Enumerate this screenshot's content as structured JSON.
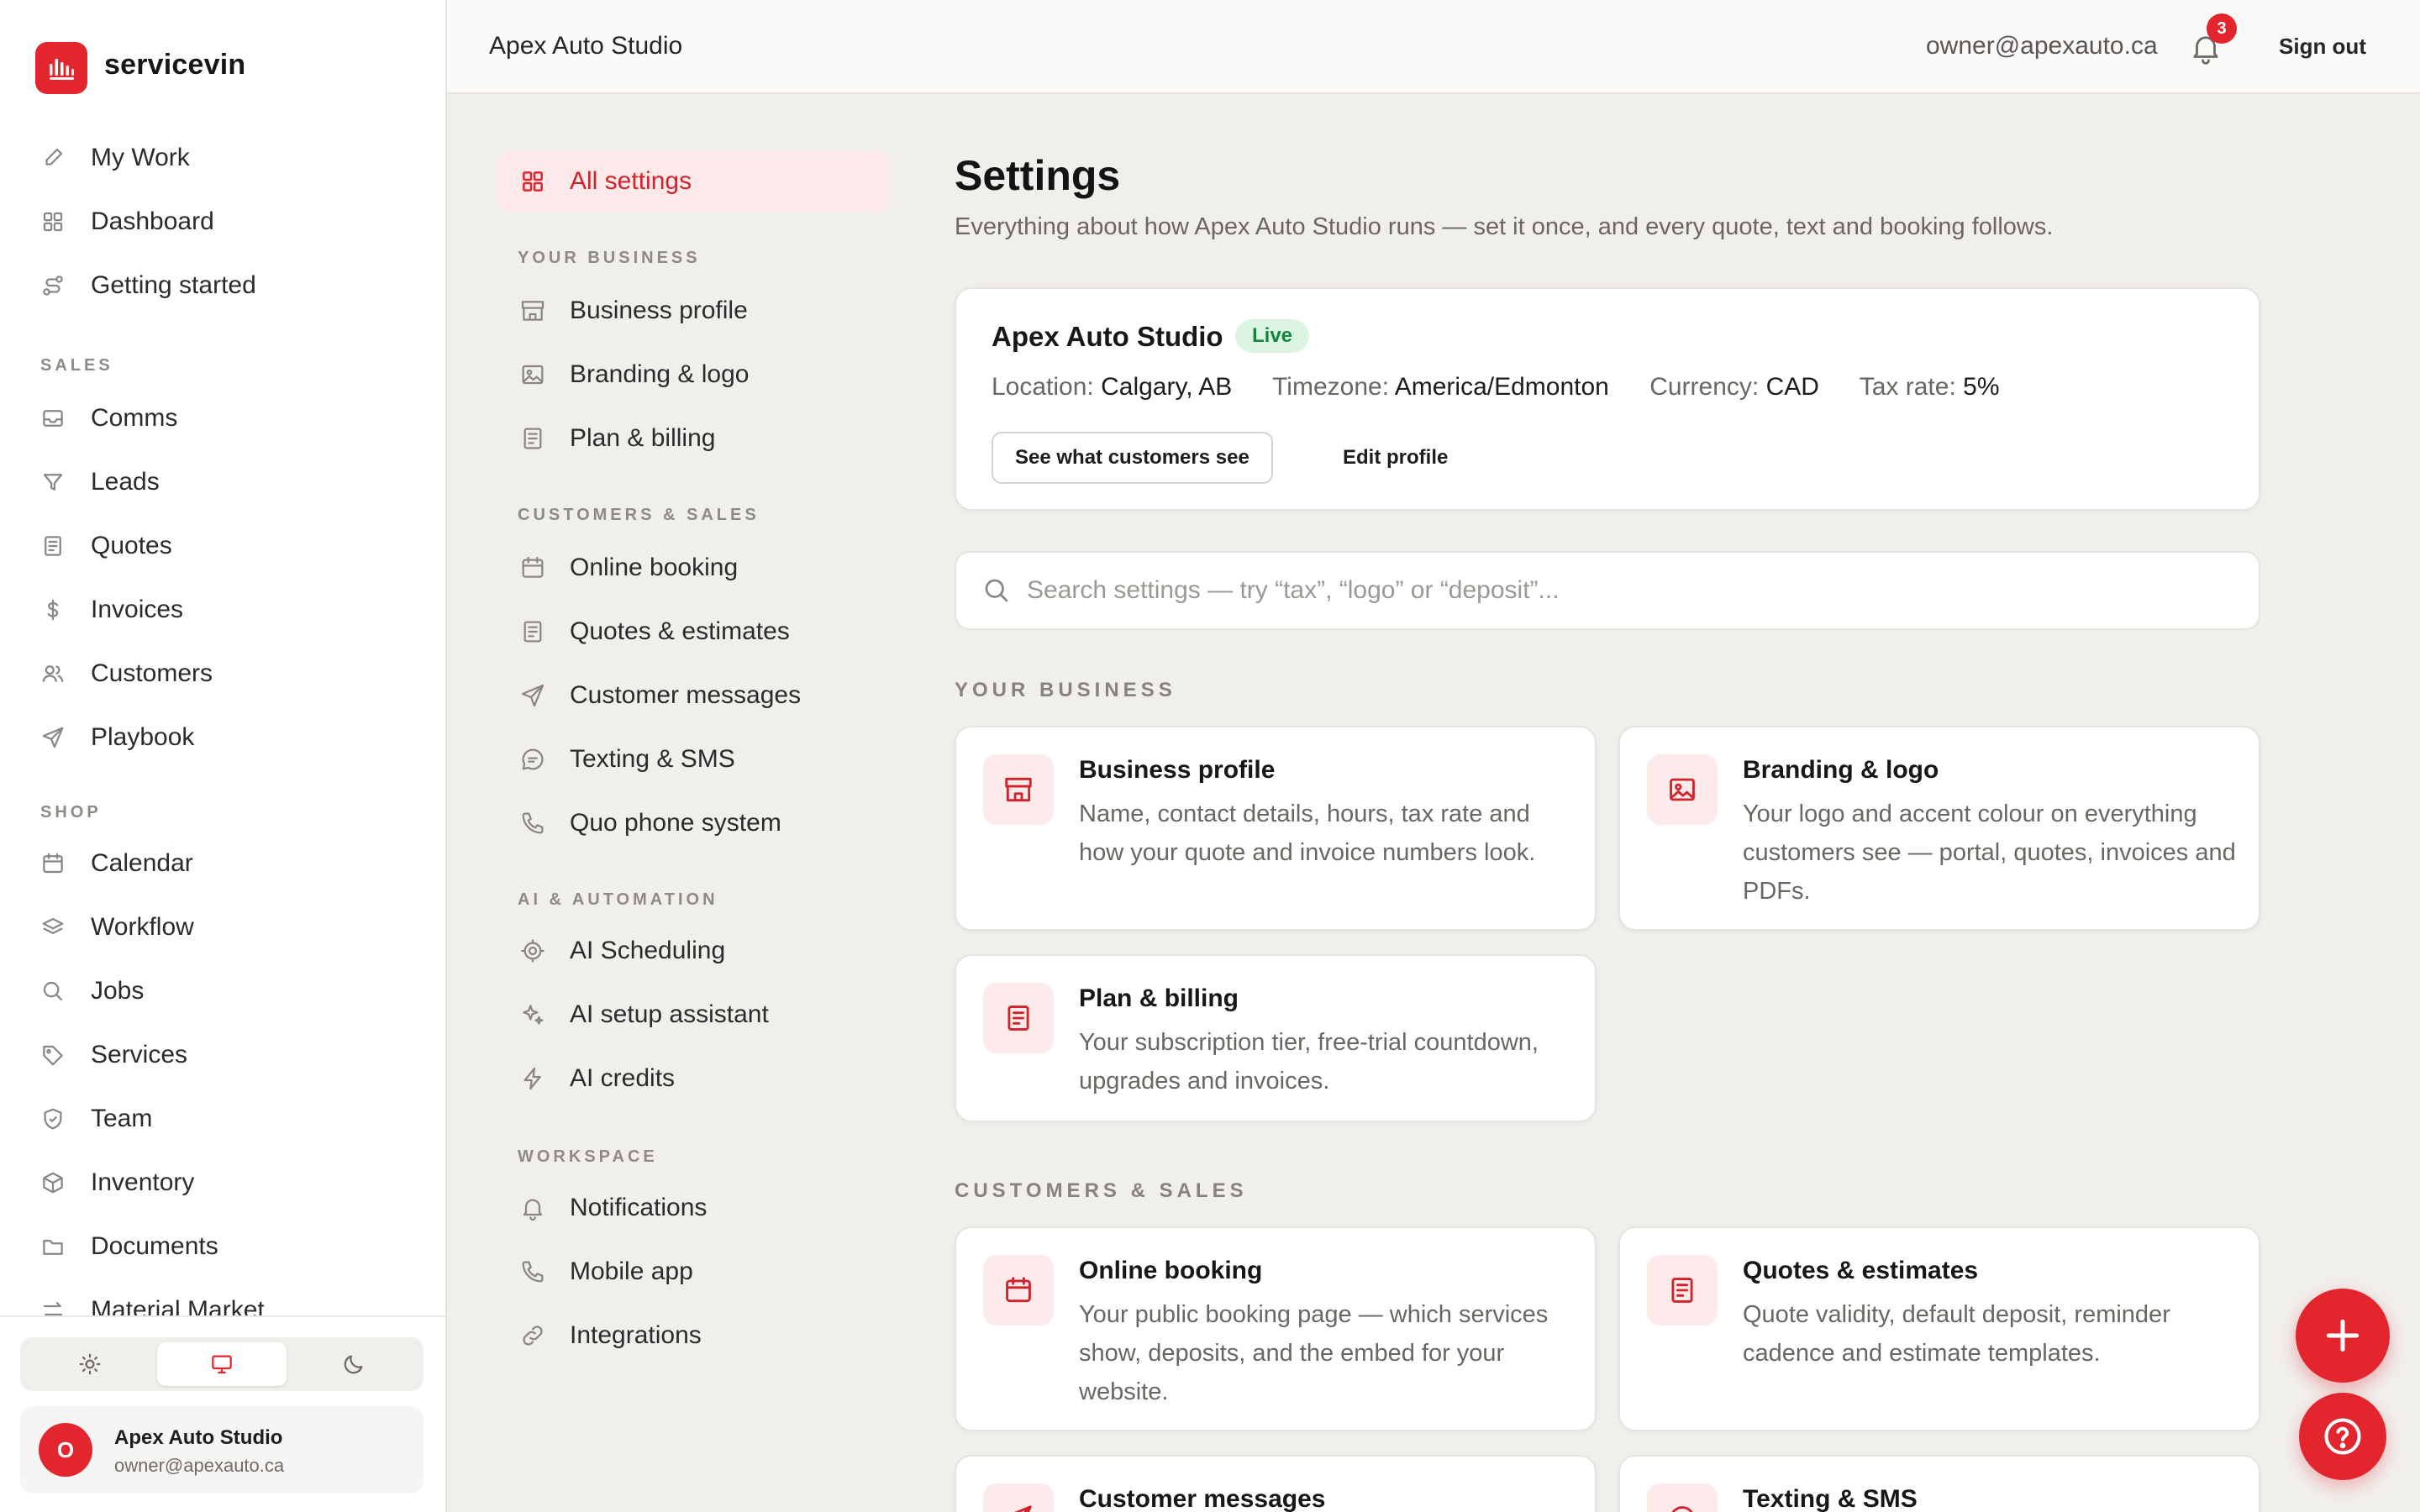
{
  "brand": {
    "name": "servicevin",
    "accent": "#e3262e"
  },
  "sidebar": {
    "items_top": [
      {
        "label": "My Work",
        "icon": "pencil-icon"
      },
      {
        "label": "Dashboard",
        "icon": "grid-icon"
      },
      {
        "label": "Getting started",
        "icon": "route-icon"
      }
    ],
    "sales_label": "SALES",
    "sales": [
      {
        "label": "Comms",
        "icon": "inbox-icon"
      },
      {
        "label": "Leads",
        "icon": "filter-icon"
      },
      {
        "label": "Quotes",
        "icon": "document-icon"
      },
      {
        "label": "Invoices",
        "icon": "dollar-icon"
      },
      {
        "label": "Customers",
        "icon": "users-icon"
      },
      {
        "label": "Playbook",
        "icon": "send-icon"
      }
    ],
    "shop_label": "SHOP",
    "shop": [
      {
        "label": "Calendar",
        "icon": "calendar-icon"
      },
      {
        "label": "Workflow",
        "icon": "layers-icon"
      },
      {
        "label": "Jobs",
        "icon": "search-icon"
      },
      {
        "label": "Services",
        "icon": "tag-icon"
      },
      {
        "label": "Team",
        "icon": "shield-icon"
      },
      {
        "label": "Inventory",
        "icon": "box-icon"
      },
      {
        "label": "Documents",
        "icon": "folder-icon"
      },
      {
        "label": "Material Market",
        "icon": "arrows-icon"
      }
    ],
    "account": {
      "initial": "O",
      "name": "Apex Auto Studio",
      "email": "owner@apexauto.ca"
    }
  },
  "topbar": {
    "title": "Apex Auto Studio",
    "email": "owner@apexauto.ca",
    "notifications": "3",
    "signout": "Sign out"
  },
  "settings_nav": {
    "all": "All settings",
    "your_business_label": "YOUR BUSINESS",
    "your_business": [
      "Business profile",
      "Branding & logo",
      "Plan & billing"
    ],
    "customers_label": "CUSTOMERS & SALES",
    "customers": [
      "Online booking",
      "Quotes & estimates",
      "Customer messages",
      "Texting & SMS",
      "Quo phone system"
    ],
    "ai_label": "AI & AUTOMATION",
    "ai": [
      "AI Scheduling",
      "AI setup assistant",
      "AI credits"
    ],
    "workspace_label": "WORKSPACE",
    "workspace": [
      "Notifications",
      "Mobile app",
      "Integrations"
    ]
  },
  "main": {
    "title": "Settings",
    "subtitle": "Everything about how Apex Auto Studio runs — set it once, and every quote, text and booking follows.",
    "profile": {
      "name": "Apex Auto Studio",
      "status": "Live",
      "location_label": "Location:",
      "location": "Calgary, AB",
      "timezone_label": "Timezone:",
      "timezone": "America/Edmonton",
      "currency_label": "Currency:",
      "currency": "CAD",
      "tax_label": "Tax rate:",
      "tax": "5%",
      "see_button": "See what customers see",
      "edit_button": "Edit profile"
    },
    "search_placeholder": "Search settings — try “tax”, “logo” or “deposit”...",
    "group_your_business": "YOUR BUSINESS",
    "group_customers": "CUSTOMERS & SALES",
    "cards": [
      {
        "title": "Business profile",
        "desc": "Name, contact details, hours, tax rate and how your quote and invoice numbers look.",
        "icon": "storefront-icon"
      },
      {
        "title": "Branding & logo",
        "desc": "Your logo and accent colour on everything customers see — portal, quotes, invoices and PDFs.",
        "icon": "image-icon"
      },
      {
        "title": "Plan & billing",
        "desc": "Your subscription tier, free-trial countdown, upgrades and invoices.",
        "icon": "receipt-icon"
      },
      {
        "title": "Online booking",
        "desc": "Your public booking page — which services show, deposits, and the embed for your website.",
        "icon": "calendar-icon"
      },
      {
        "title": "Quotes & estimates",
        "desc": "Quote validity, default deposit, reminder cadence and estimate templates.",
        "icon": "receipt-icon"
      },
      {
        "title": "Customer messages",
        "desc": "",
        "icon": "send-icon"
      },
      {
        "title": "Texting & SMS",
        "desc": "",
        "icon": "chat-icon"
      }
    ]
  }
}
